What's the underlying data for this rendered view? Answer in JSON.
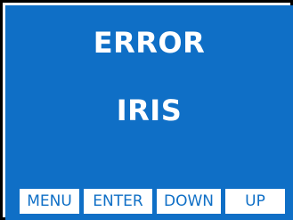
{
  "screen": {
    "title": "ERROR",
    "message": "IRIS",
    "background_color": "#0f6fc6",
    "text_color": "#ffffff"
  },
  "softkeys": {
    "menu_label": "MENU",
    "enter_label": "ENTER",
    "down_label": "DOWN",
    "up_label": "UP"
  }
}
